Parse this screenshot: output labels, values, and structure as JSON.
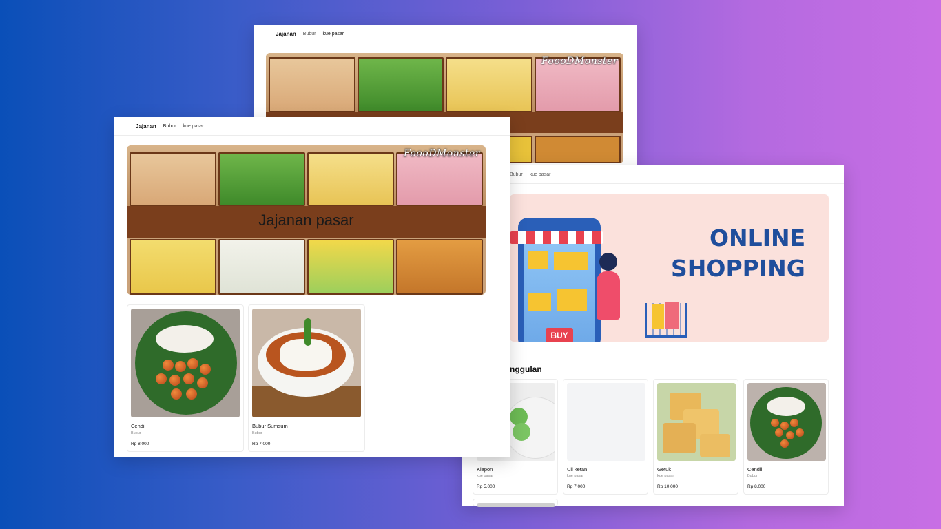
{
  "back_window": {
    "brand": "Jajanan",
    "nav": [
      "Bubur",
      "kue pasar"
    ],
    "banner_watermark": "FoooDMonster"
  },
  "front_window": {
    "brand": "Jajanan",
    "nav": [
      "Bubur",
      "kue pasar"
    ],
    "banner_watermark": "FoooDMonster",
    "banner_title": "Jajanan pasar",
    "products": [
      {
        "name": "Cendil",
        "category": "Bubur",
        "price": "Rp 8.000"
      },
      {
        "name": "Bubur Sumsum",
        "category": "Bubur",
        "price": "Rp 7.000"
      }
    ]
  },
  "right_window": {
    "nav": [
      "Bubur",
      "kue pasar"
    ],
    "promo": {
      "line1": "ONLINE",
      "line2": "SHOPPING",
      "buy_label": "BUY"
    },
    "section_title": "nggulan",
    "products": [
      {
        "name": "Klepon",
        "category": "kue pasar",
        "price": "Rp 5.000"
      },
      {
        "name": "Uli ketan",
        "category": "kue pasar",
        "price": "Rp 7.000"
      },
      {
        "name": "Getuk",
        "category": "kue pasar",
        "price": "Rp 10.000"
      },
      {
        "name": "Cendil",
        "category": "Bubur",
        "price": "Rp 8.000"
      }
    ]
  },
  "colors": {
    "bg_left": "#0a4fb8",
    "bg_right": "#c86ee4",
    "promo_bg": "#fbe1dc",
    "promo_text": "#1f4e9c"
  }
}
